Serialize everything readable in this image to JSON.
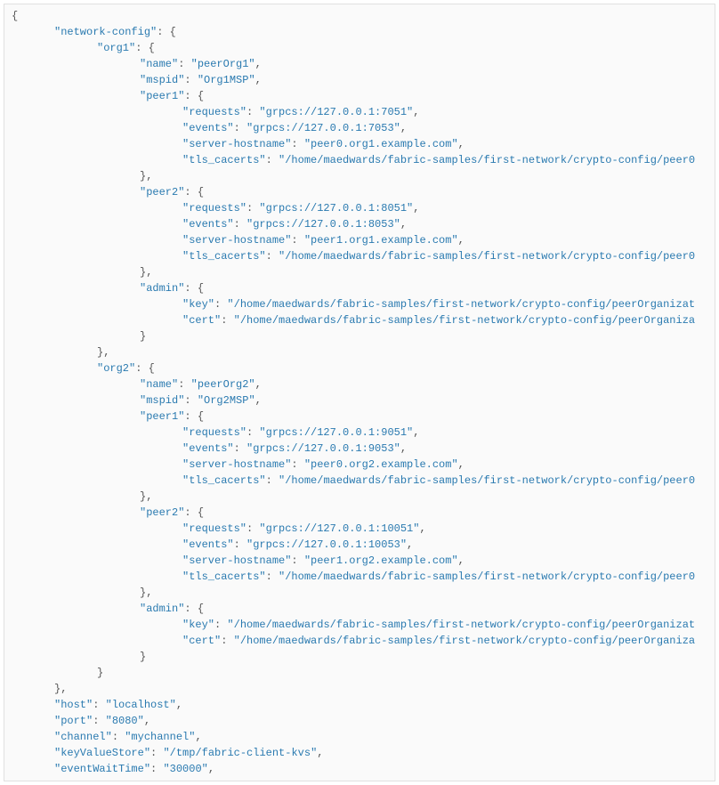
{
  "lines": [
    {
      "indent": 0,
      "text": "{"
    },
    {
      "indent": 1,
      "key": "\"network-config\"",
      "after": ": {"
    },
    {
      "indent": 2,
      "key": "\"org1\"",
      "after": ": {"
    },
    {
      "indent": 3,
      "key": "\"name\"",
      "val": "\"peerOrg1\"",
      "comma": true
    },
    {
      "indent": 3,
      "key": "\"mspid\"",
      "val": "\"Org1MSP\"",
      "comma": true
    },
    {
      "indent": 3,
      "key": "\"peer1\"",
      "after": ": {"
    },
    {
      "indent": 4,
      "key": "\"requests\"",
      "val": "\"grpcs://127.0.0.1:7051\"",
      "comma": true
    },
    {
      "indent": 4,
      "key": "\"events\"",
      "val": "\"grpcs://127.0.0.1:7053\"",
      "comma": true
    },
    {
      "indent": 4,
      "key": "\"server-hostname\"",
      "val": "\"peer0.org1.example.com\"",
      "comma": true
    },
    {
      "indent": 4,
      "key": "\"tls_cacerts\"",
      "val": "\"/home/maedwards/fabric-samples/first-network/crypto-config/peer0"
    },
    {
      "indent": 3,
      "text": "},"
    },
    {
      "indent": 3,
      "key": "\"peer2\"",
      "after": ": {"
    },
    {
      "indent": 4,
      "key": "\"requests\"",
      "val": "\"grpcs://127.0.0.1:8051\"",
      "comma": true
    },
    {
      "indent": 4,
      "key": "\"events\"",
      "val": "\"grpcs://127.0.0.1:8053\"",
      "comma": true
    },
    {
      "indent": 4,
      "key": "\"server-hostname\"",
      "val": "\"peer1.org1.example.com\"",
      "comma": true
    },
    {
      "indent": 4,
      "key": "\"tls_cacerts\"",
      "val": "\"/home/maedwards/fabric-samples/first-network/crypto-config/peer0"
    },
    {
      "indent": 3,
      "text": "},"
    },
    {
      "indent": 3,
      "key": "\"admin\"",
      "after": ": {"
    },
    {
      "indent": 4,
      "key": "\"key\"",
      "val": "\"/home/maedwards/fabric-samples/first-network/crypto-config/peerOrganizat"
    },
    {
      "indent": 4,
      "key": "\"cert\"",
      "val": "\"/home/maedwards/fabric-samples/first-network/crypto-config/peerOrganiza"
    },
    {
      "indent": 3,
      "text": "}"
    },
    {
      "indent": 2,
      "text": "},"
    },
    {
      "indent": 2,
      "key": "\"org2\"",
      "after": ": {"
    },
    {
      "indent": 3,
      "key": "\"name\"",
      "val": "\"peerOrg2\"",
      "comma": true
    },
    {
      "indent": 3,
      "key": "\"mspid\"",
      "val": "\"Org2MSP\"",
      "comma": true
    },
    {
      "indent": 3,
      "key": "\"peer1\"",
      "after": ": {"
    },
    {
      "indent": 4,
      "key": "\"requests\"",
      "val": "\"grpcs://127.0.0.1:9051\"",
      "comma": true
    },
    {
      "indent": 4,
      "key": "\"events\"",
      "val": "\"grpcs://127.0.0.1:9053\"",
      "comma": true
    },
    {
      "indent": 4,
      "key": "\"server-hostname\"",
      "val": "\"peer0.org2.example.com\"",
      "comma": true
    },
    {
      "indent": 4,
      "key": "\"tls_cacerts\"",
      "val": "\"/home/maedwards/fabric-samples/first-network/crypto-config/peer0"
    },
    {
      "indent": 3,
      "text": "},"
    },
    {
      "indent": 3,
      "key": "\"peer2\"",
      "after": ": {"
    },
    {
      "indent": 4,
      "key": "\"requests\"",
      "val": "\"grpcs://127.0.0.1:10051\"",
      "comma": true
    },
    {
      "indent": 4,
      "key": "\"events\"",
      "val": "\"grpcs://127.0.0.1:10053\"",
      "comma": true
    },
    {
      "indent": 4,
      "key": "\"server-hostname\"",
      "val": "\"peer1.org2.example.com\"",
      "comma": true
    },
    {
      "indent": 4,
      "key": "\"tls_cacerts\"",
      "val": "\"/home/maedwards/fabric-samples/first-network/crypto-config/peer0"
    },
    {
      "indent": 3,
      "text": "},"
    },
    {
      "indent": 3,
      "key": "\"admin\"",
      "after": ": {"
    },
    {
      "indent": 4,
      "key": "\"key\"",
      "val": "\"/home/maedwards/fabric-samples/first-network/crypto-config/peerOrganizat"
    },
    {
      "indent": 4,
      "key": "\"cert\"",
      "val": "\"/home/maedwards/fabric-samples/first-network/crypto-config/peerOrganiza"
    },
    {
      "indent": 3,
      "text": "}"
    },
    {
      "indent": 2,
      "text": "}"
    },
    {
      "indent": 1,
      "text": "},"
    },
    {
      "indent": 1,
      "key": "\"host\"",
      "val": "\"localhost\"",
      "comma": true
    },
    {
      "indent": 1,
      "key": "\"port\"",
      "val": "\"8080\"",
      "comma": true
    },
    {
      "indent": 1,
      "key": "\"channel\"",
      "val": "\"mychannel\"",
      "comma": true
    },
    {
      "indent": 1,
      "key": "\"keyValueStore\"",
      "val": "\"/tmp/fabric-client-kvs\"",
      "comma": true
    },
    {
      "indent": 1,
      "key": "\"eventWaitTime\"",
      "val": "\"30000\"",
      "comma": true
    }
  ]
}
